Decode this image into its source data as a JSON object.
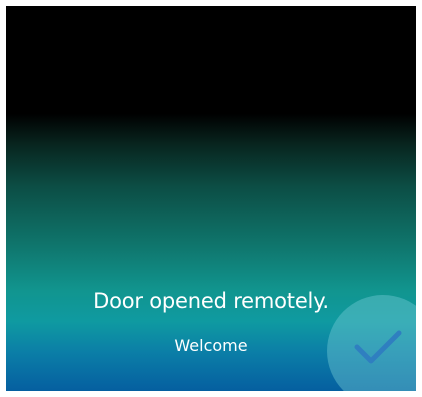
{
  "screen": {
    "message": "Door opened remotely.",
    "subtitle": "Welcome",
    "icon": "checkmark-icon",
    "colors": {
      "top": "#000000",
      "middle": "#11958f",
      "bottom": "#055fa0",
      "check": "#2f7fc0"
    }
  }
}
